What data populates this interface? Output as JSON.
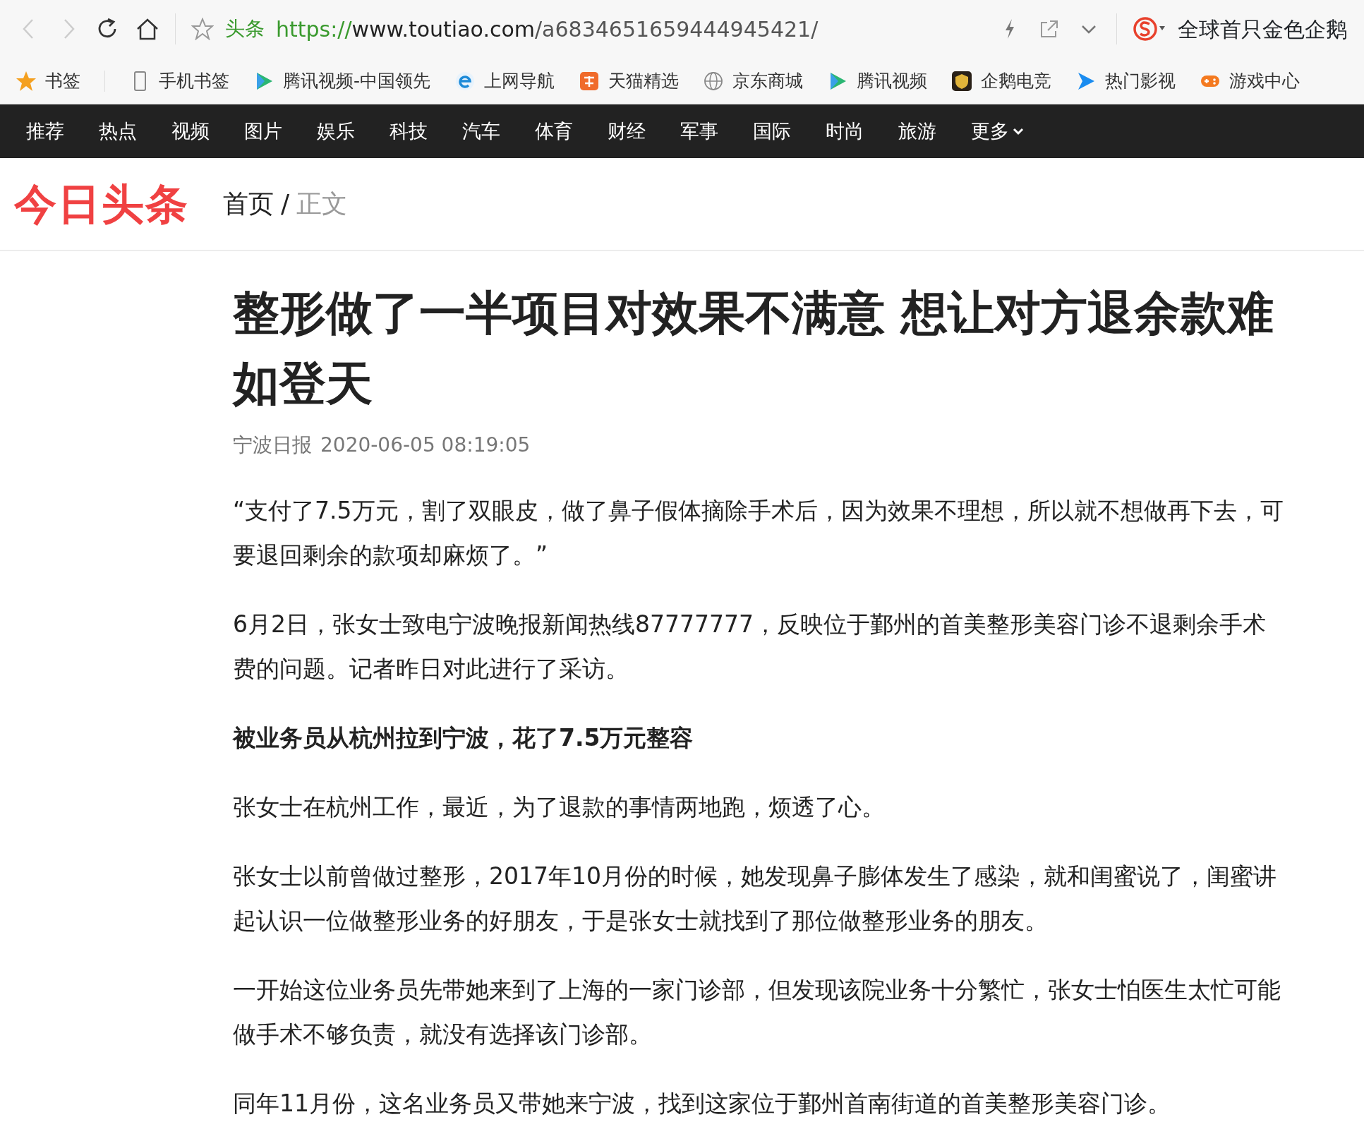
{
  "browser": {
    "site_label": "头条",
    "url": {
      "scheme": "https://",
      "host": "www.toutiao.com",
      "path": "/a6834651659444945421/"
    },
    "promo": "全球首只金色企鹅"
  },
  "bookmarks": [
    {
      "label": "书签",
      "kind": "star"
    },
    {
      "label": "手机书签",
      "kind": "phone"
    },
    {
      "label": "腾讯视频-中国领先",
      "kind": "play"
    },
    {
      "label": "上网导航",
      "kind": "e"
    },
    {
      "label": "天猫精选",
      "kind": "tile"
    },
    {
      "label": "京东商城",
      "kind": "globe"
    },
    {
      "label": "腾讯视频",
      "kind": "play"
    },
    {
      "label": "企鹅电竞",
      "kind": "badge"
    },
    {
      "label": "热门影视",
      "kind": "arrow"
    },
    {
      "label": "游戏中心",
      "kind": "gamepad"
    }
  ],
  "nav": {
    "items": [
      "推荐",
      "热点",
      "视频",
      "图片",
      "娱乐",
      "科技",
      "汽车",
      "体育",
      "财经",
      "军事",
      "国际",
      "时尚",
      "旅游"
    ],
    "more": "更多"
  },
  "header": {
    "logo": "今日头条",
    "breadcrumb": [
      "首页",
      "正文"
    ],
    "separator": "/"
  },
  "article": {
    "title": "整形做了一半项目对效果不满意 想让对方退余款难如登天",
    "source": "宁波日报",
    "time": "2020-06-05 08:19:05",
    "blocks": [
      {
        "kind": "paragraph",
        "text": "“支付了7.5万元，割了双眼皮，做了鼻子假体摘除手术后，因为效果不理想，所以就不想做再下去，可要退回剩余的款项却麻烦了。”"
      },
      {
        "kind": "paragraph",
        "text": "6月2日，张女士致电宁波晚报新闻热线87777777，反映位于鄞州的首美整形美容门诊不退剩余手术费的问题。记者昨日对此进行了采访。"
      },
      {
        "kind": "heading",
        "text": "被业务员从杭州拉到宁波，花了7.5万元整容"
      },
      {
        "kind": "paragraph",
        "text": "张女士在杭州工作，最近，为了退款的事情两地跑，烦透了心。"
      },
      {
        "kind": "paragraph",
        "text": "张女士以前曾做过整形，2017年10月份的时候，她发现鼻子膨体发生了感染，就和闺蜜说了，闺蜜讲起认识一位做整形业务的好朋友，于是张女士就找到了那位做整形业务的朋友。"
      },
      {
        "kind": "paragraph",
        "text": "一开始这位业务员先带她来到了上海的一家门诊部，但发现该院业务十分繁忙，张女士怕医生太忙可能做手术不够负责，就没有选择该门诊部。"
      },
      {
        "kind": "paragraph",
        "text": "同年11月份，这名业务员又带她来宁波，找到这家位于鄞州首南街道的首美整形美容门诊。"
      }
    ]
  }
}
